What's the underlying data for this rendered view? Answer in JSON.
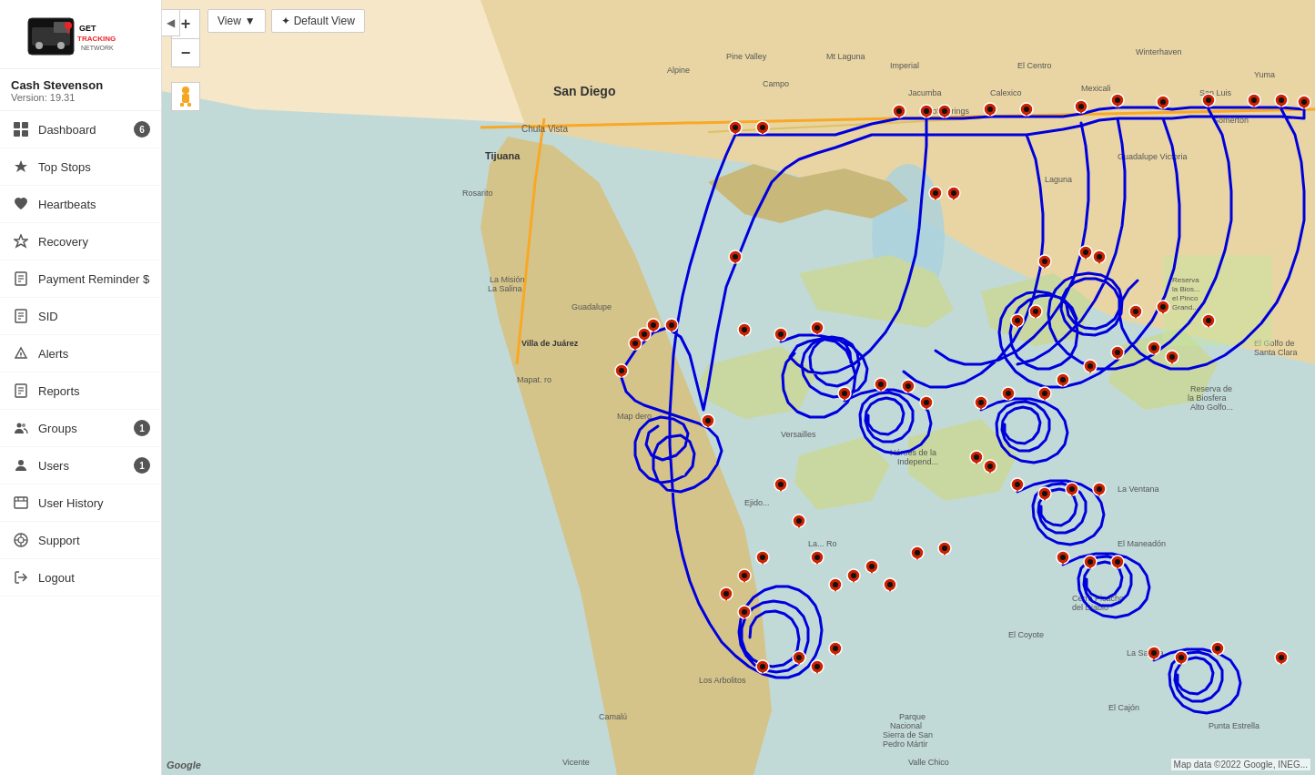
{
  "app": {
    "title": "GetTracking Network"
  },
  "user": {
    "name": "Cash Stevenson",
    "version_label": "Version: 19.31"
  },
  "sidebar": {
    "items": [
      {
        "id": "dashboard",
        "label": "Dashboard",
        "icon": "dashboard",
        "badge": "6"
      },
      {
        "id": "top-stops",
        "label": "Top Stops",
        "icon": "top-stops",
        "badge": null
      },
      {
        "id": "heartbeats",
        "label": "Heartbeats",
        "icon": "heartbeats",
        "badge": null
      },
      {
        "id": "recovery",
        "label": "Recovery",
        "icon": "recovery",
        "badge": null
      },
      {
        "id": "payment-reminder",
        "label": "Payment Reminder $",
        "icon": "payment",
        "badge": null
      },
      {
        "id": "sid",
        "label": "SID",
        "icon": "key",
        "badge": null
      },
      {
        "id": "alerts",
        "label": "Alerts",
        "icon": "alerts",
        "badge": null
      },
      {
        "id": "reports",
        "label": "Reports",
        "icon": "reports",
        "badge": null
      },
      {
        "id": "groups",
        "label": "Groups",
        "icon": "groups",
        "badge": "1"
      },
      {
        "id": "users",
        "label": "Users",
        "icon": "users",
        "badge": "1"
      },
      {
        "id": "user-history",
        "label": "User History",
        "icon": "user-history",
        "badge": null
      },
      {
        "id": "support",
        "label": "Support",
        "icon": "support",
        "badge": null
      },
      {
        "id": "logout",
        "label": "Logout",
        "icon": "logout",
        "badge": null
      }
    ]
  },
  "map": {
    "view_btn": "View",
    "default_view_btn": "Default View",
    "zoom_in": "+",
    "zoom_out": "−",
    "google_label": "Google",
    "attribution": "Map data ©2022 Google, INEG..."
  },
  "collapse": {
    "icon": "◀"
  }
}
